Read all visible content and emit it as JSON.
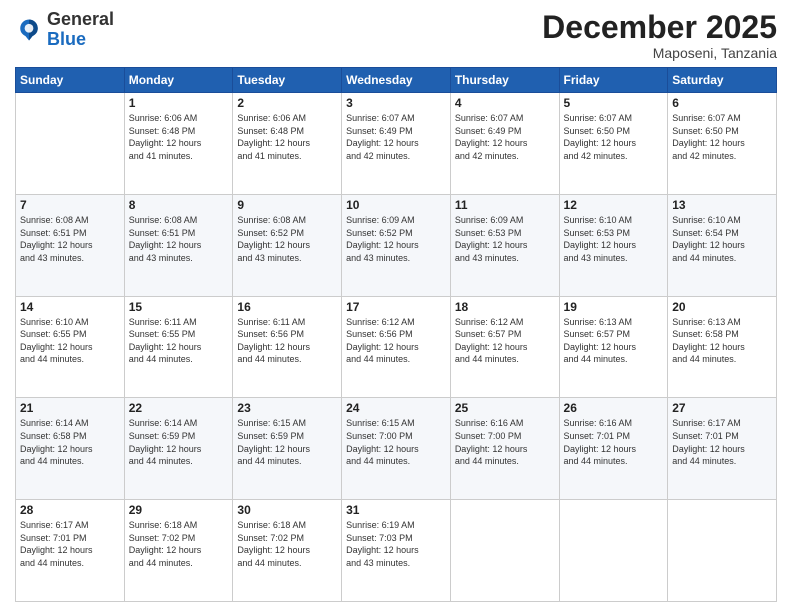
{
  "logo": {
    "general": "General",
    "blue": "Blue"
  },
  "title": "December 2025",
  "location": "Maposeni, Tanzania",
  "days_of_week": [
    "Sunday",
    "Monday",
    "Tuesday",
    "Wednesday",
    "Thursday",
    "Friday",
    "Saturday"
  ],
  "weeks": [
    [
      {
        "day": "",
        "info": ""
      },
      {
        "day": "1",
        "info": "Sunrise: 6:06 AM\nSunset: 6:48 PM\nDaylight: 12 hours\nand 41 minutes."
      },
      {
        "day": "2",
        "info": "Sunrise: 6:06 AM\nSunset: 6:48 PM\nDaylight: 12 hours\nand 41 minutes."
      },
      {
        "day": "3",
        "info": "Sunrise: 6:07 AM\nSunset: 6:49 PM\nDaylight: 12 hours\nand 42 minutes."
      },
      {
        "day": "4",
        "info": "Sunrise: 6:07 AM\nSunset: 6:49 PM\nDaylight: 12 hours\nand 42 minutes."
      },
      {
        "day": "5",
        "info": "Sunrise: 6:07 AM\nSunset: 6:50 PM\nDaylight: 12 hours\nand 42 minutes."
      },
      {
        "day": "6",
        "info": "Sunrise: 6:07 AM\nSunset: 6:50 PM\nDaylight: 12 hours\nand 42 minutes."
      }
    ],
    [
      {
        "day": "7",
        "info": "Sunrise: 6:08 AM\nSunset: 6:51 PM\nDaylight: 12 hours\nand 43 minutes."
      },
      {
        "day": "8",
        "info": "Sunrise: 6:08 AM\nSunset: 6:51 PM\nDaylight: 12 hours\nand 43 minutes."
      },
      {
        "day": "9",
        "info": "Sunrise: 6:08 AM\nSunset: 6:52 PM\nDaylight: 12 hours\nand 43 minutes."
      },
      {
        "day": "10",
        "info": "Sunrise: 6:09 AM\nSunset: 6:52 PM\nDaylight: 12 hours\nand 43 minutes."
      },
      {
        "day": "11",
        "info": "Sunrise: 6:09 AM\nSunset: 6:53 PM\nDaylight: 12 hours\nand 43 minutes."
      },
      {
        "day": "12",
        "info": "Sunrise: 6:10 AM\nSunset: 6:53 PM\nDaylight: 12 hours\nand 43 minutes."
      },
      {
        "day": "13",
        "info": "Sunrise: 6:10 AM\nSunset: 6:54 PM\nDaylight: 12 hours\nand 44 minutes."
      }
    ],
    [
      {
        "day": "14",
        "info": "Sunrise: 6:10 AM\nSunset: 6:55 PM\nDaylight: 12 hours\nand 44 minutes."
      },
      {
        "day": "15",
        "info": "Sunrise: 6:11 AM\nSunset: 6:55 PM\nDaylight: 12 hours\nand 44 minutes."
      },
      {
        "day": "16",
        "info": "Sunrise: 6:11 AM\nSunset: 6:56 PM\nDaylight: 12 hours\nand 44 minutes."
      },
      {
        "day": "17",
        "info": "Sunrise: 6:12 AM\nSunset: 6:56 PM\nDaylight: 12 hours\nand 44 minutes."
      },
      {
        "day": "18",
        "info": "Sunrise: 6:12 AM\nSunset: 6:57 PM\nDaylight: 12 hours\nand 44 minutes."
      },
      {
        "day": "19",
        "info": "Sunrise: 6:13 AM\nSunset: 6:57 PM\nDaylight: 12 hours\nand 44 minutes."
      },
      {
        "day": "20",
        "info": "Sunrise: 6:13 AM\nSunset: 6:58 PM\nDaylight: 12 hours\nand 44 minutes."
      }
    ],
    [
      {
        "day": "21",
        "info": "Sunrise: 6:14 AM\nSunset: 6:58 PM\nDaylight: 12 hours\nand 44 minutes."
      },
      {
        "day": "22",
        "info": "Sunrise: 6:14 AM\nSunset: 6:59 PM\nDaylight: 12 hours\nand 44 minutes."
      },
      {
        "day": "23",
        "info": "Sunrise: 6:15 AM\nSunset: 6:59 PM\nDaylight: 12 hours\nand 44 minutes."
      },
      {
        "day": "24",
        "info": "Sunrise: 6:15 AM\nSunset: 7:00 PM\nDaylight: 12 hours\nand 44 minutes."
      },
      {
        "day": "25",
        "info": "Sunrise: 6:16 AM\nSunset: 7:00 PM\nDaylight: 12 hours\nand 44 minutes."
      },
      {
        "day": "26",
        "info": "Sunrise: 6:16 AM\nSunset: 7:01 PM\nDaylight: 12 hours\nand 44 minutes."
      },
      {
        "day": "27",
        "info": "Sunrise: 6:17 AM\nSunset: 7:01 PM\nDaylight: 12 hours\nand 44 minutes."
      }
    ],
    [
      {
        "day": "28",
        "info": "Sunrise: 6:17 AM\nSunset: 7:01 PM\nDaylight: 12 hours\nand 44 minutes."
      },
      {
        "day": "29",
        "info": "Sunrise: 6:18 AM\nSunset: 7:02 PM\nDaylight: 12 hours\nand 44 minutes."
      },
      {
        "day": "30",
        "info": "Sunrise: 6:18 AM\nSunset: 7:02 PM\nDaylight: 12 hours\nand 44 minutes."
      },
      {
        "day": "31",
        "info": "Sunrise: 6:19 AM\nSunset: 7:03 PM\nDaylight: 12 hours\nand 43 minutes."
      },
      {
        "day": "",
        "info": ""
      },
      {
        "day": "",
        "info": ""
      },
      {
        "day": "",
        "info": ""
      }
    ]
  ]
}
